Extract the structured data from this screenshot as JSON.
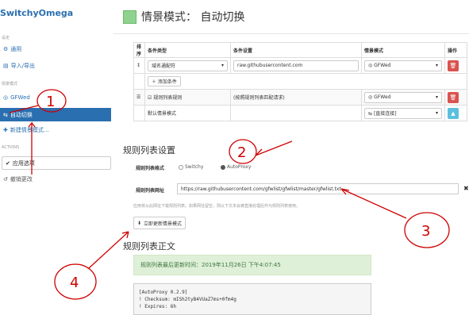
{
  "sidebar": {
    "logo": "SwitchyOmega",
    "section_settings": "设定",
    "items": [
      {
        "label": "通用"
      },
      {
        "label": "导入/导出"
      }
    ],
    "section_profiles": "情景模式",
    "profiles": [
      {
        "label": "GFWed"
      },
      {
        "label": "自动切换"
      },
      {
        "label": "新建情景模式..."
      }
    ],
    "section_actions": "ACTIONS",
    "actions": [
      {
        "label": "应用选项"
      },
      {
        "label": "撤销更改"
      }
    ]
  },
  "header": {
    "title": "情景模式： 自动切换",
    "color": "#8fd28f"
  },
  "rules_table": {
    "headers": [
      "排序",
      "条件类型",
      "条件设置",
      "情景模式",
      "操作"
    ],
    "rows": [
      {
        "type": "域名通配符",
        "pattern": "raw.githubusercontent.com",
        "profile": "GFWed"
      },
      {
        "type": "规则列表规则",
        "pattern": "(按照规则列表匹配请求)",
        "profile": "GFWed"
      },
      {
        "type": "默认情景模式",
        "pattern": "",
        "profile": "[直接连接]"
      }
    ],
    "add_condition": "添加条件"
  },
  "rule_list_settings": {
    "heading": "规则列表设置",
    "format_label": "规则列表格式",
    "format_options": [
      "Switchy",
      "AutoProxy"
    ],
    "url_label": "规则列表网址",
    "url_value": "https://raw.githubusercontent.com/gfwlist/gfwlist/master/gfwlist.txt",
    "help": "应用将从此网址下载规则列表。如果网址留空，则以下文本会被直接处理后作为规则列表使用。",
    "update_button": "立即更新情景模式"
  },
  "rule_list_text": {
    "heading": "规则列表正文",
    "last_updated": "规则列表最后更新时间：2019年11月26日 下午4:07:45",
    "content": "[AutoProxy 0.2.9]\n! Checksum: mISh2tyB4VUaZ7ms+0fm4g\n! Expires: 6h"
  },
  "annotations": [
    "1",
    "2",
    "3",
    "4"
  ],
  "colors": {
    "accent": "#2a6fb0",
    "annotation": "#d00000",
    "danger": "#d9534f",
    "info": "#5bc0de"
  }
}
